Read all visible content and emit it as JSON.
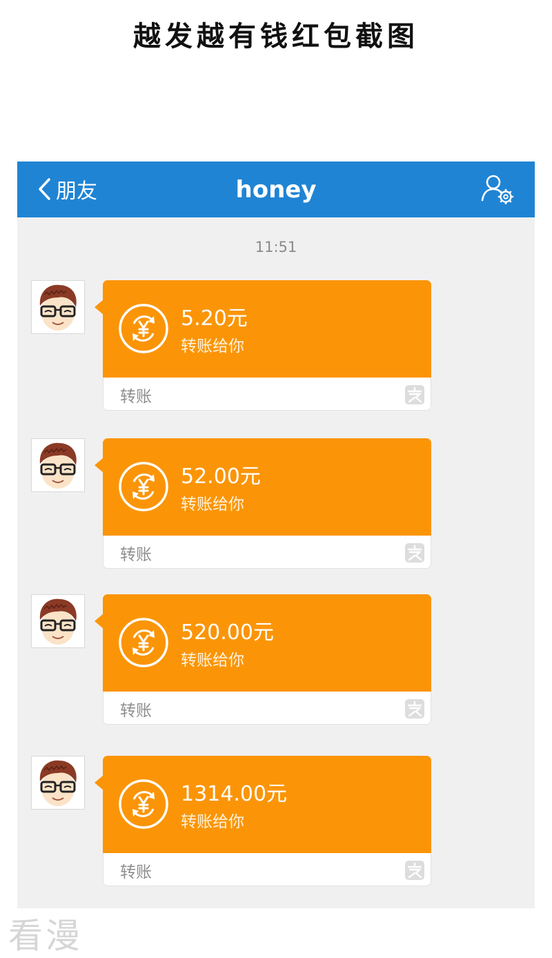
{
  "caption": "越发越有钱红包截图",
  "navbar": {
    "back_label": "朋友",
    "title": "honey"
  },
  "time": "11:51",
  "messages": [
    {
      "amount": "5.20元",
      "desc": "转账给你",
      "type": "转账"
    },
    {
      "amount": "52.00元",
      "desc": "转账给你",
      "type": "转账"
    },
    {
      "amount": "520.00元",
      "desc": "转账给你",
      "type": "转账"
    },
    {
      "amount": "1314.00元",
      "desc": "转账给你",
      "type": "转账"
    }
  ],
  "watermark": "看漫",
  "colors": {
    "navbar": "#2084d4",
    "bubble": "#fb9507",
    "background": "#f0f0f0"
  },
  "icons": [
    "chevron-left-icon",
    "profile-settings-icon",
    "transfer-coin-icon",
    "alipay-icon",
    "avatar-cartoon"
  ]
}
